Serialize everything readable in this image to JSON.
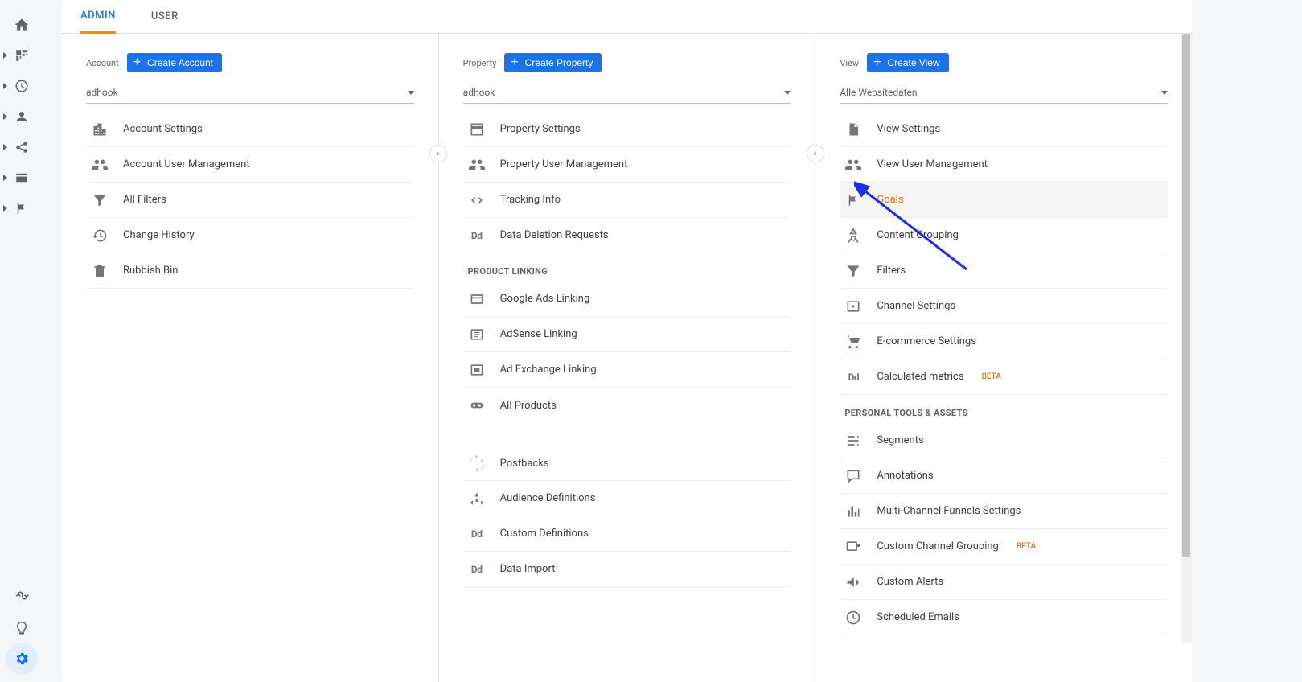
{
  "tabs": {
    "admin": "ADMIN",
    "user": "USER"
  },
  "account": {
    "label": "Account",
    "create": "Create Account",
    "selector": "adhook",
    "items": [
      "Account Settings",
      "Account User Management",
      "All Filters",
      "Change History",
      "Rubbish Bin"
    ]
  },
  "property": {
    "label": "Property",
    "create": "Create Property",
    "selector": "adhook",
    "items": [
      "Property Settings",
      "Property User Management",
      "Tracking Info",
      "Data Deletion Requests"
    ],
    "product_linking_title": "PRODUCT LINKING",
    "product_linking": [
      "Google Ads Linking",
      "AdSense Linking",
      "Ad Exchange Linking",
      "All Products"
    ],
    "more": [
      "Postbacks",
      "Audience Definitions",
      "Custom Definitions",
      "Data Import"
    ]
  },
  "view": {
    "label": "View",
    "create": "Create View",
    "selector": "Alle Websitedaten",
    "items": [
      "View Settings",
      "View User Management",
      "Goals",
      "Content Grouping",
      "Filters",
      "Channel Settings",
      "E-commerce Settings",
      "Calculated metrics"
    ],
    "beta": "BETA",
    "personal_title": "PERSONAL TOOLS & ASSETS",
    "personal": [
      "Segments",
      "Annotations",
      "Multi-Channel Funnels Settings",
      "Custom Channel Grouping",
      "Custom Alerts",
      "Scheduled Emails"
    ]
  }
}
